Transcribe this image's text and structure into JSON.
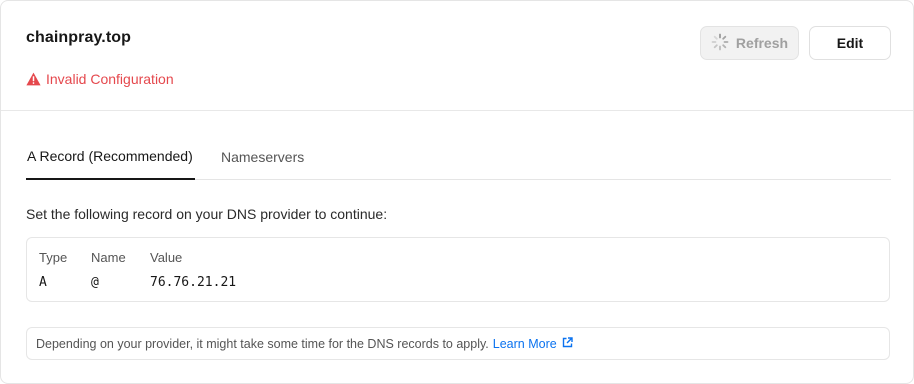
{
  "domain": {
    "name": "chainpray.top",
    "status": "Invalid Configuration",
    "status_color": "#e5484d"
  },
  "actions": {
    "refresh_label": "Refresh",
    "refresh_state": "loading",
    "edit_label": "Edit"
  },
  "tabs": [
    {
      "label": "A Record (Recommended)",
      "active": true
    },
    {
      "label": "Nameservers",
      "active": false
    }
  ],
  "instructions": "Set the following record on your DNS provider to continue:",
  "record": {
    "headers": {
      "type": "Type",
      "name": "Name",
      "value": "Value"
    },
    "row": {
      "type": "A",
      "name": "@",
      "value": "76.76.21.21"
    }
  },
  "note": {
    "text": "Depending on your provider, it might take some time for the DNS records to apply.",
    "link_label": "Learn More",
    "link_color": "#0a72ef"
  },
  "icons": {
    "status": "warning-triangle-icon",
    "refresh": "spinner-icon",
    "link": "external-link-icon"
  }
}
